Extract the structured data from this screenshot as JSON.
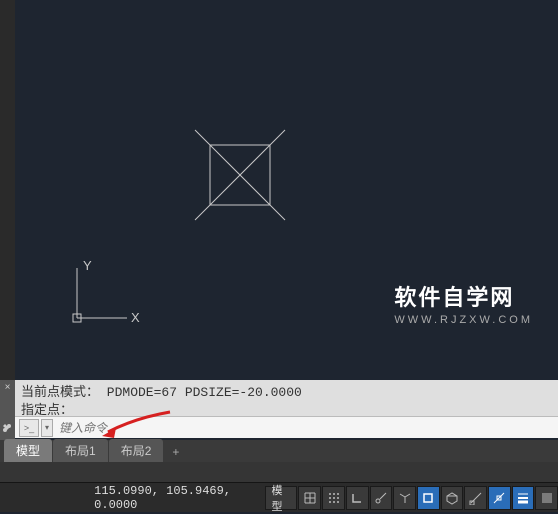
{
  "canvas": {
    "ucs": {
      "x_label": "X",
      "y_label": "Y"
    }
  },
  "watermark": {
    "title": "软件自学网",
    "url": "WWW.RJZXW.COM"
  },
  "command": {
    "history_line1": "当前点模式：  PDMODE=67  PDSIZE=-20.0000",
    "history_line2": "指定点：",
    "input_placeholder": "键入命令"
  },
  "tabs": {
    "items": [
      {
        "label": "模型",
        "active": true
      },
      {
        "label": "布局1",
        "active": false
      },
      {
        "label": "布局2",
        "active": false
      }
    ],
    "add_label": "+"
  },
  "status": {
    "coords": "115.0990, 105.9469, 0.0000",
    "model_label": "模型"
  }
}
